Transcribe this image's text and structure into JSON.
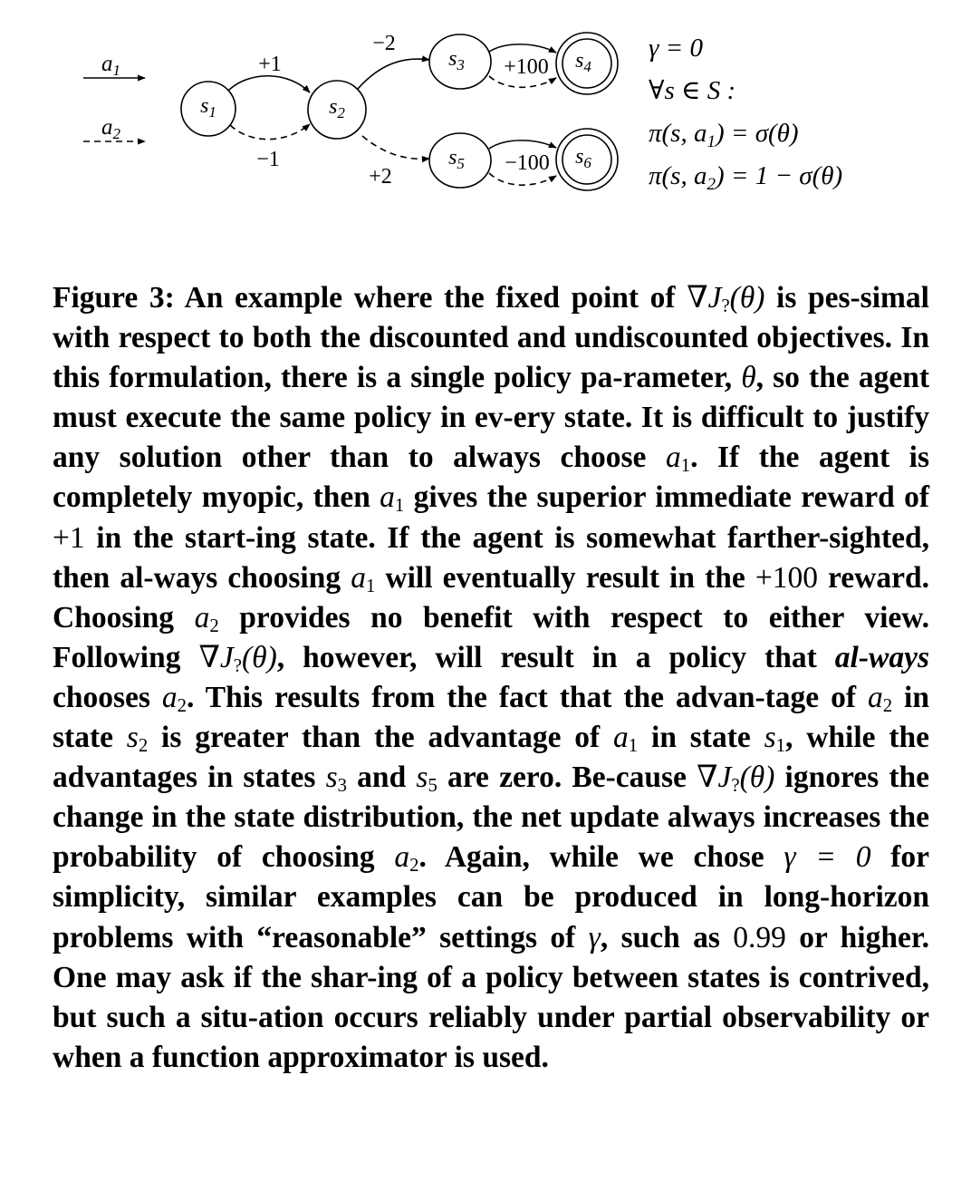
{
  "figure": {
    "legend": {
      "a1": {
        "base": "a",
        "sub": "1"
      },
      "a2": {
        "base": "a",
        "sub": "2"
      }
    },
    "states": [
      {
        "id": "s1",
        "base": "s",
        "sub": "1",
        "terminal": false
      },
      {
        "id": "s2",
        "base": "s",
        "sub": "2",
        "terminal": false
      },
      {
        "id": "s3",
        "base": "s",
        "sub": "3",
        "terminal": false
      },
      {
        "id": "s4",
        "base": "s",
        "sub": "4",
        "terminal": true
      },
      {
        "id": "s5",
        "base": "s",
        "sub": "5",
        "terminal": false
      },
      {
        "id": "s6",
        "base": "s",
        "sub": "6",
        "terminal": true
      }
    ],
    "rewards": {
      "s1_a1": "+1",
      "s1_a2": "−1",
      "s2_a1": "−2",
      "s2_a2": "+2",
      "s3": "+100",
      "s5": "−100"
    },
    "equations": {
      "gamma": "γ = 0",
      "forall": "∀s ∈ S :",
      "pi_a1_lhs": "π(s, a",
      "pi_a1_sub": "1",
      "pi_a1_rhs": ") = σ(θ)",
      "pi_a2_lhs": "π(s, a",
      "pi_a2_sub": "2",
      "pi_a2_rhs": ") = 1 − σ(θ)"
    }
  },
  "caption": {
    "label": "Figure 3:",
    "t01": " An example where the fixed point of ",
    "grad": "∇J",
    "grad_sub": "?",
    "grad_arg": "(θ)",
    "t02": " is pes-simal with respect to both the discounted and undiscounted objectives. In this formulation, there is a single policy pa-rameter, ",
    "theta": "θ",
    "t03": ", so the agent must execute the same policy in ev-ery state. It is difficult to justify any solution other than to always choose ",
    "a": "a",
    "s": "s",
    "sub1": "1",
    "sub2": "2",
    "sub3": "3",
    "sub5": "5",
    "t04": ". If the agent is completely myopic, then ",
    "t05": " gives the superior immediate reward of ",
    "plus1": "+1",
    "t06": " in the start-ing state. If the agent is somewhat farther-sighted, then al-ways choosing ",
    "t07": " will eventually result in the ",
    "plus100": "+100",
    "t08": " reward. Choosing ",
    "t09": " provides no benefit with respect to either view. Following ",
    "t10": ", however, will result in a policy that ",
    "always": "al-ways",
    "t11": " chooses ",
    "t12": ". This results from the fact that the advan-tage of ",
    "t13": " in state ",
    "t14": " is greater than the advantage of ",
    "t15": " in state ",
    "t16": ", while the advantages in states ",
    "t17": " and ",
    "t18": " are zero. Be-cause ",
    "t19": " ignores the change in the state distribution, the net update always increases the probability of choosing ",
    "t20": ". Again, while we chose ",
    "gamma_eq": "γ = 0",
    "t21": " for simplicity, similar examples can be produced in long-horizon problems with “reasonable” settings of ",
    "gamma": "γ",
    "t22": ", such as ",
    "val099": "0.99",
    "t23": " or higher. One may ask if the shar-ing of a policy between states is contrived, but such a situ-ation occurs reliably under partial observability or when a function approximator is used."
  }
}
